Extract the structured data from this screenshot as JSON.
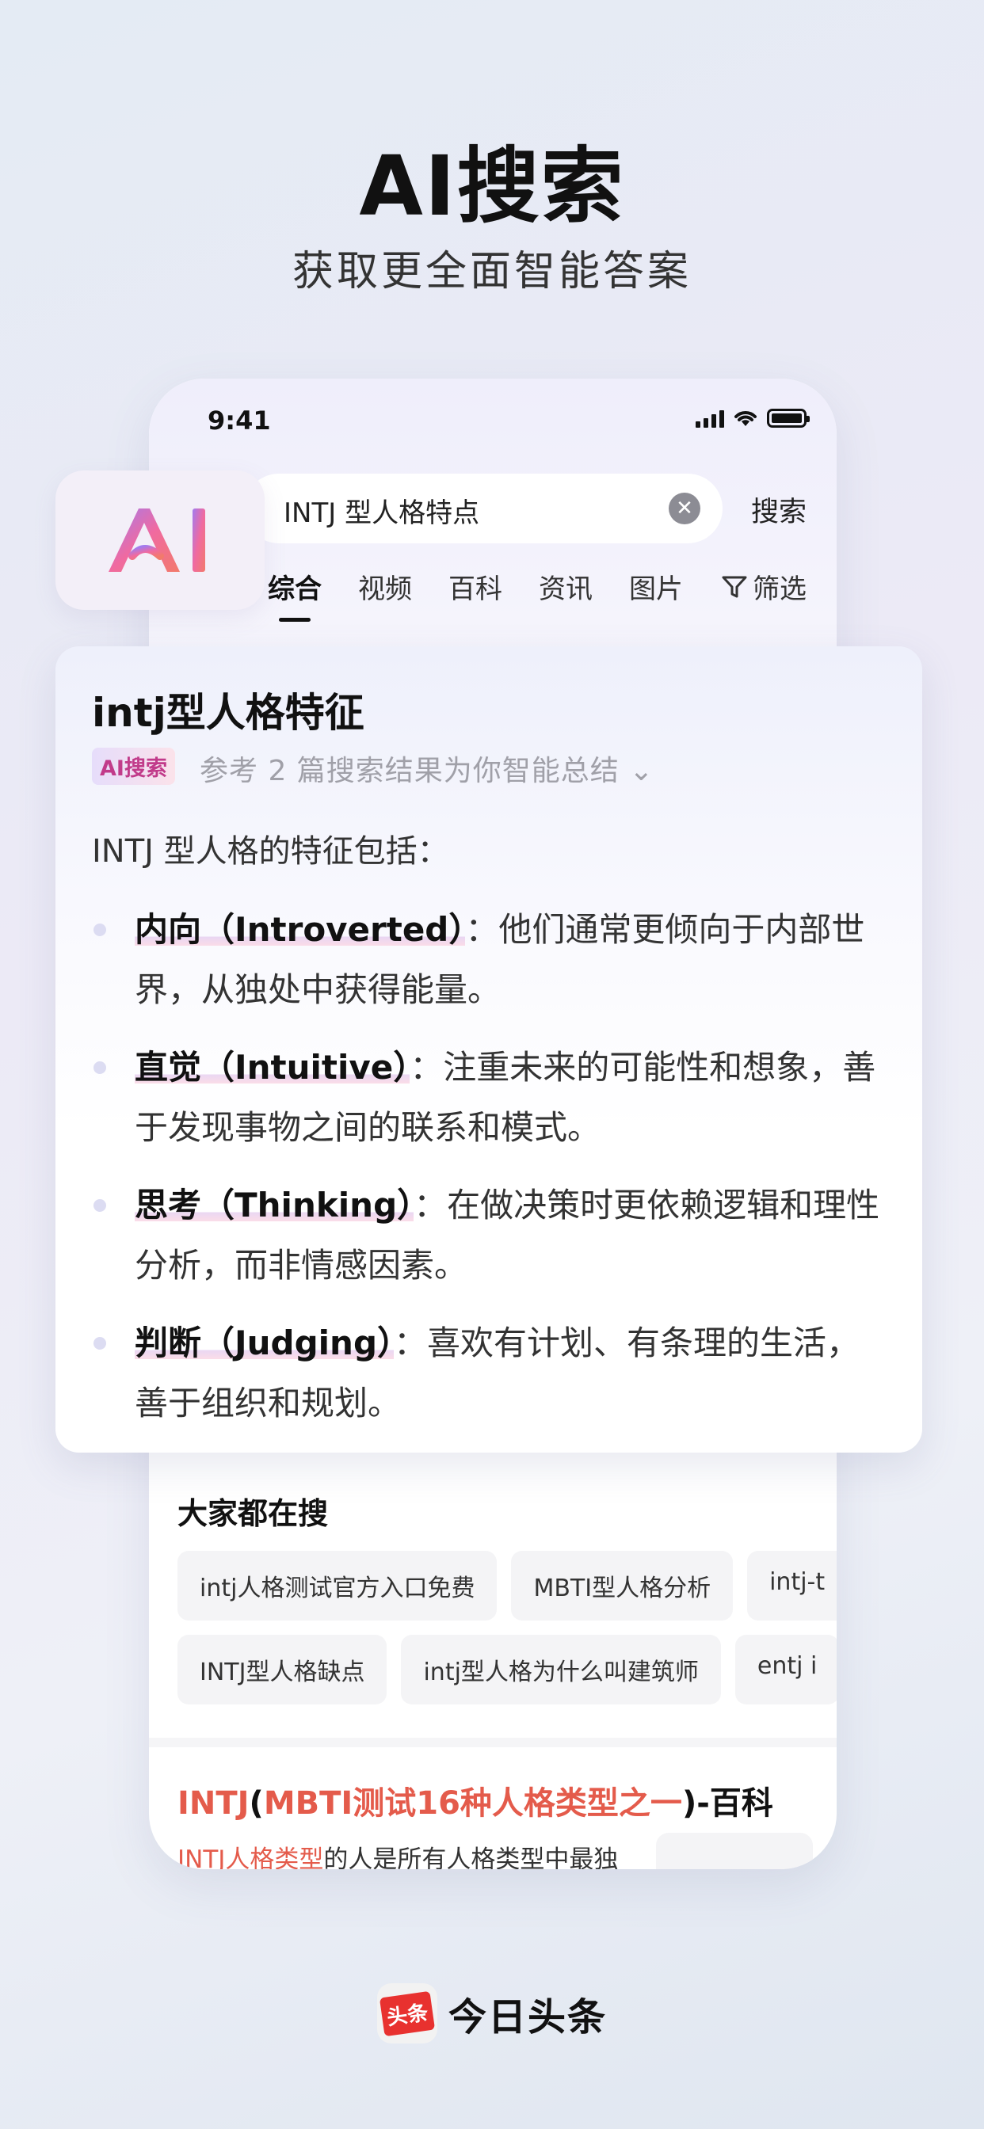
{
  "hero": {
    "title": "AI搜索",
    "subtitle": "获取更全面智能答案"
  },
  "status_bar": {
    "time": "9:41"
  },
  "search": {
    "query": "INTJ 型人格特点",
    "submit_label": "搜索"
  },
  "tabs": [
    {
      "label": "综合",
      "active": true
    },
    {
      "label": "视频",
      "active": false
    },
    {
      "label": "百科",
      "active": false
    },
    {
      "label": "资讯",
      "active": false
    },
    {
      "label": "图片",
      "active": false
    }
  ],
  "filter_label": "筛选",
  "ai_badge_text": "AI",
  "answer_card": {
    "title": "intj型人格特征",
    "tag": "AI搜索",
    "reference": "参考 2 篇搜索结果为你智能总结",
    "intro": "INTJ 型人格的特征包括：",
    "items": [
      {
        "term": "内向（Introverted）",
        "desc": "：他们通常更倾向于内部世界，从独处中获得能量。"
      },
      {
        "term": "直觉（Intuitive）",
        "desc": "：注重未来的可能性和想象，善于发现事物之间的联系和模式。"
      },
      {
        "term": "思考（Thinking）",
        "desc": "：在做决策时更依赖逻辑和理性分析，而非情感因素。"
      },
      {
        "term": "判断（Judging）",
        "desc": "：喜欢有计划、有条理的生活，善于组织和规划。"
      }
    ]
  },
  "hot_searches": {
    "title": "大家都在搜",
    "row1": [
      "intj人格测试官方入口免费",
      "MBTI型人格分析",
      "intj-t"
    ],
    "row2": [
      "INTJ型人格缺点",
      "intj型人格为什么叫建筑师",
      "entj i"
    ]
  },
  "result": {
    "title_part1": "INTJ",
    "title_part2": "(",
    "title_part3": "MBTI测试16种人格类型之一",
    "title_part4": ")-百科",
    "snippet_hl": "INTJ人格类型",
    "snippet_rest": "的人是所有人格类型中最独"
  },
  "footer": {
    "logo_text": "头条",
    "app_name": "今日头条"
  },
  "colors": {
    "accent_red": "#e45b4b",
    "brand_red": "#e8312f"
  }
}
